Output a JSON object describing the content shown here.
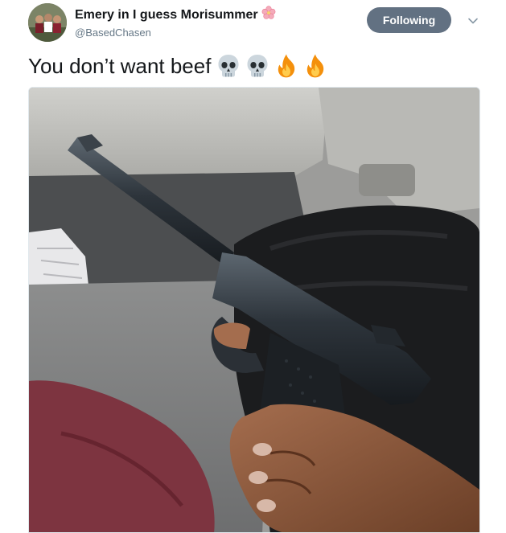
{
  "author": {
    "display_name": "Emery in I guess Morisummer",
    "name_emoji": "cherry-blossom-icon",
    "handle": "@BasedChasen",
    "avatar": "avatar-photo"
  },
  "follow_button": {
    "label": "Following"
  },
  "menu": {
    "icon": "chevron-down-icon"
  },
  "tweet": {
    "text": "You don’t want beef",
    "emojis": [
      "skull-icon",
      "skull-icon",
      "fire-icon",
      "fire-icon"
    ]
  },
  "media": {
    "type": "photo",
    "subject": "photo-in-car"
  },
  "colors": {
    "following_button": "#627182",
    "name_text": "#14171a",
    "handle_text": "#657786",
    "border": "#e1e8ed"
  }
}
